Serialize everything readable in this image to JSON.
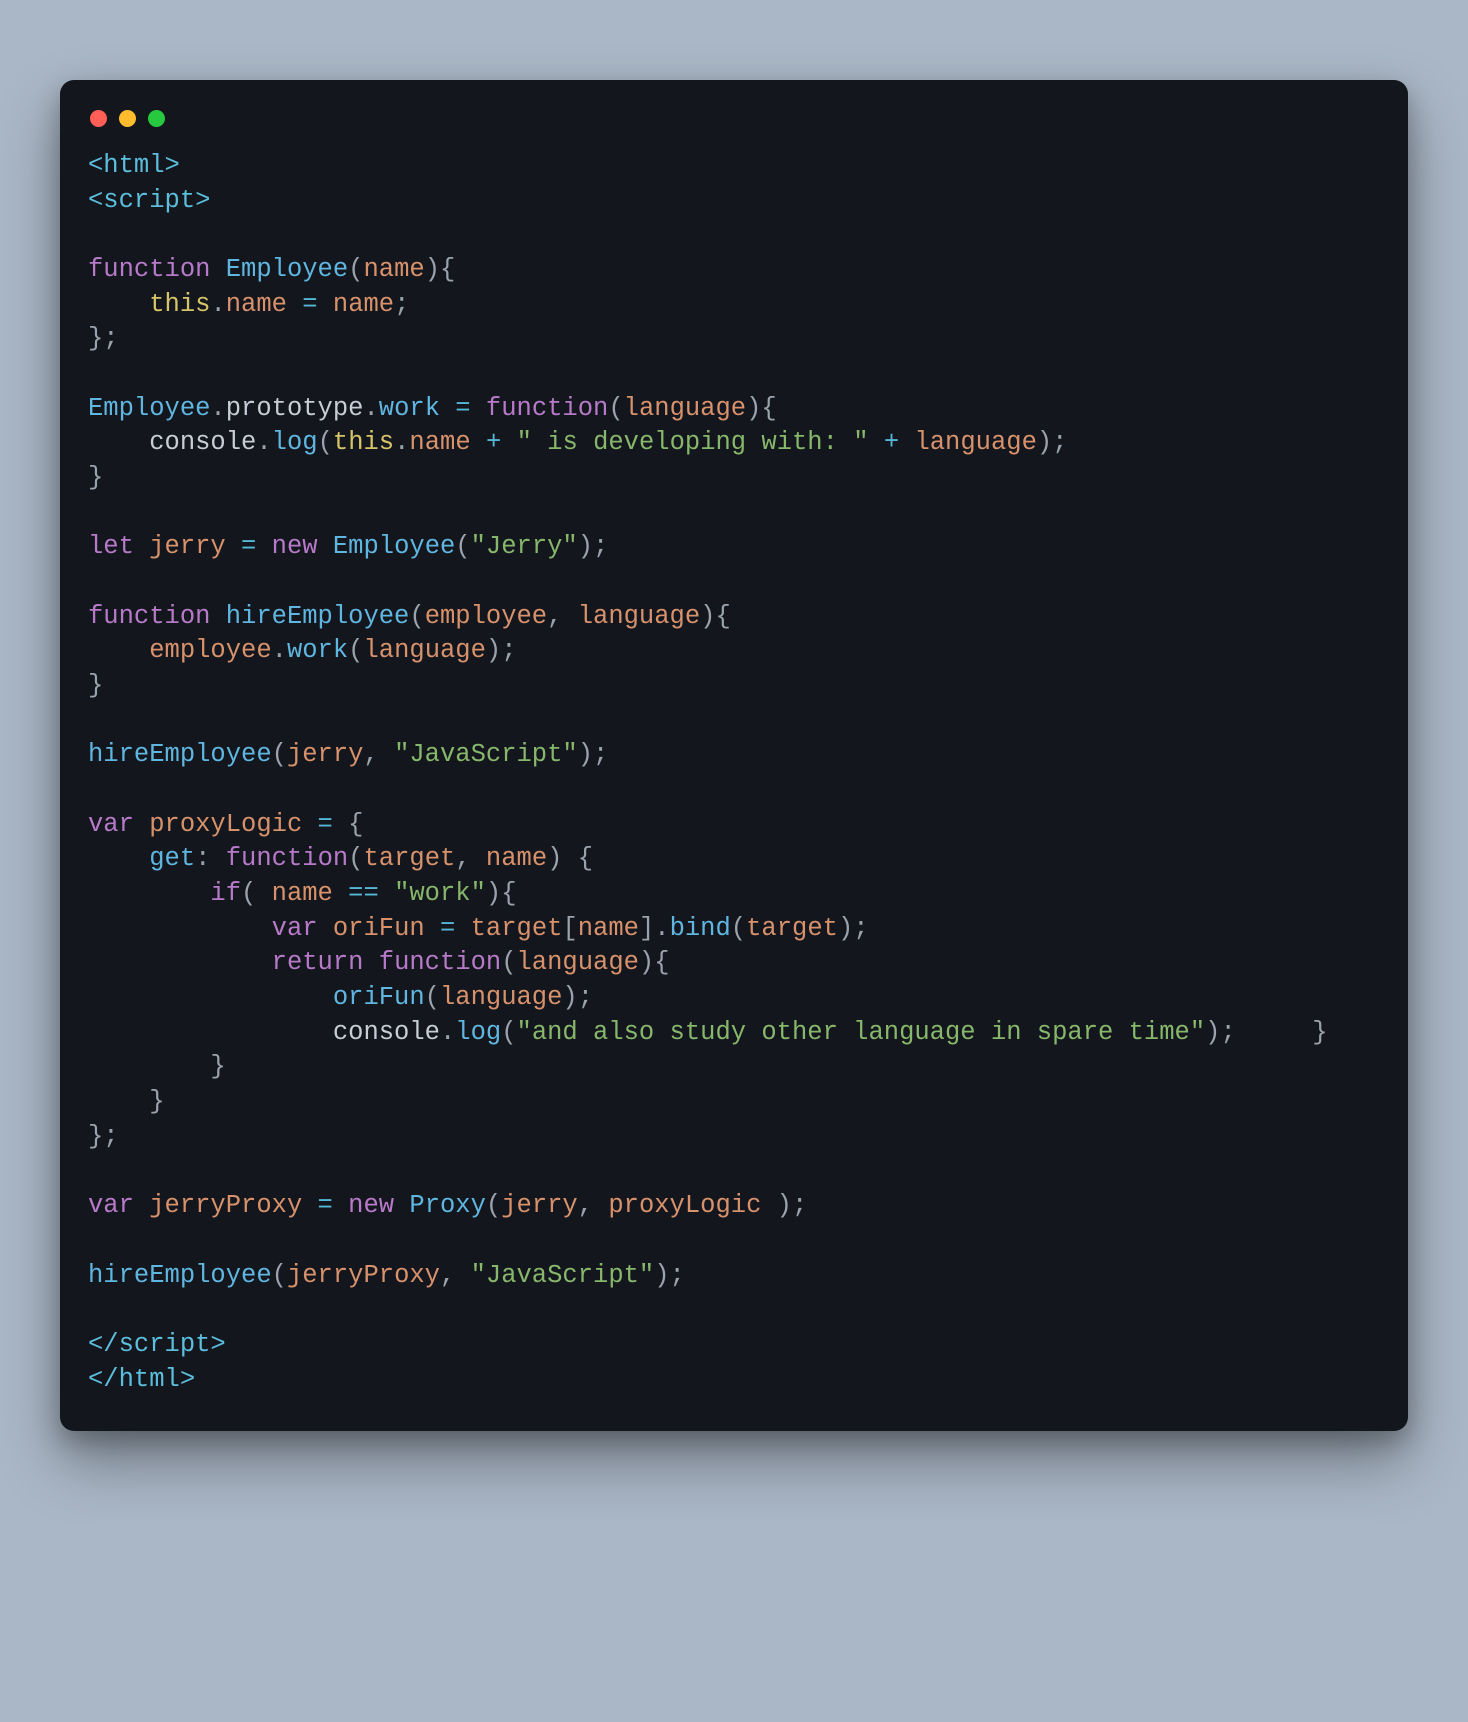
{
  "window": {
    "dots": [
      "red",
      "yellow",
      "green"
    ]
  },
  "code": {
    "tokens": [
      {
        "t": "<html>",
        "c": "tag"
      },
      {
        "t": "\n"
      },
      {
        "t": "<script>",
        "c": "tag"
      },
      {
        "t": "\n"
      },
      {
        "t": "\n"
      },
      {
        "t": "function ",
        "c": "kw"
      },
      {
        "t": "Employee",
        "c": "fn"
      },
      {
        "t": "(",
        "c": "punc"
      },
      {
        "t": "name",
        "c": "prop"
      },
      {
        "t": "){",
        "c": "punc"
      },
      {
        "t": "\n"
      },
      {
        "t": "    "
      },
      {
        "t": "this",
        "c": "this"
      },
      {
        "t": ".",
        "c": "punc"
      },
      {
        "t": "name",
        "c": "prop"
      },
      {
        "t": " = ",
        "c": "op"
      },
      {
        "t": "name",
        "c": "prop"
      },
      {
        "t": ";",
        "c": "punc"
      },
      {
        "t": "\n"
      },
      {
        "t": "};",
        "c": "punc"
      },
      {
        "t": "\n"
      },
      {
        "t": "\n"
      },
      {
        "t": "Employee",
        "c": "fn"
      },
      {
        "t": ".",
        "c": "punc"
      },
      {
        "t": "prototype",
        "c": "dotid"
      },
      {
        "t": ".",
        "c": "punc"
      },
      {
        "t": "work",
        "c": "fn"
      },
      {
        "t": " = ",
        "c": "op"
      },
      {
        "t": "function",
        "c": "kw"
      },
      {
        "t": "(",
        "c": "punc"
      },
      {
        "t": "language",
        "c": "prop"
      },
      {
        "t": "){",
        "c": "punc"
      },
      {
        "t": "\n"
      },
      {
        "t": "    "
      },
      {
        "t": "console",
        "c": "dotid"
      },
      {
        "t": ".",
        "c": "punc"
      },
      {
        "t": "log",
        "c": "fn"
      },
      {
        "t": "(",
        "c": "punc"
      },
      {
        "t": "this",
        "c": "this"
      },
      {
        "t": ".",
        "c": "punc"
      },
      {
        "t": "name",
        "c": "prop"
      },
      {
        "t": " + ",
        "c": "op"
      },
      {
        "t": "\" is developing with: \"",
        "c": "str"
      },
      {
        "t": " + ",
        "c": "op"
      },
      {
        "t": "language",
        "c": "prop"
      },
      {
        "t": ");",
        "c": "punc"
      },
      {
        "t": "\n"
      },
      {
        "t": "}",
        "c": "punc"
      },
      {
        "t": "\n"
      },
      {
        "t": "\n"
      },
      {
        "t": "let ",
        "c": "kw"
      },
      {
        "t": "jerry",
        "c": "prop"
      },
      {
        "t": " = ",
        "c": "op"
      },
      {
        "t": "new ",
        "c": "kw"
      },
      {
        "t": "Employee",
        "c": "fn"
      },
      {
        "t": "(",
        "c": "punc"
      },
      {
        "t": "\"Jerry\"",
        "c": "str"
      },
      {
        "t": ");",
        "c": "punc"
      },
      {
        "t": "\n"
      },
      {
        "t": "\n"
      },
      {
        "t": "function ",
        "c": "kw"
      },
      {
        "t": "hireEmployee",
        "c": "fn"
      },
      {
        "t": "(",
        "c": "punc"
      },
      {
        "t": "employee",
        "c": "prop"
      },
      {
        "t": ", ",
        "c": "punc"
      },
      {
        "t": "language",
        "c": "prop"
      },
      {
        "t": "){",
        "c": "punc"
      },
      {
        "t": "\n"
      },
      {
        "t": "    "
      },
      {
        "t": "employee",
        "c": "prop"
      },
      {
        "t": ".",
        "c": "punc"
      },
      {
        "t": "work",
        "c": "fn"
      },
      {
        "t": "(",
        "c": "punc"
      },
      {
        "t": "language",
        "c": "prop"
      },
      {
        "t": ");",
        "c": "punc"
      },
      {
        "t": "\n"
      },
      {
        "t": "}",
        "c": "punc"
      },
      {
        "t": "\n"
      },
      {
        "t": "\n"
      },
      {
        "t": "hireEmployee",
        "c": "fn"
      },
      {
        "t": "(",
        "c": "punc"
      },
      {
        "t": "jerry",
        "c": "prop"
      },
      {
        "t": ", ",
        "c": "punc"
      },
      {
        "t": "\"JavaScript\"",
        "c": "str"
      },
      {
        "t": ");",
        "c": "punc"
      },
      {
        "t": "\n"
      },
      {
        "t": "\n"
      },
      {
        "t": "var ",
        "c": "kw"
      },
      {
        "t": "proxyLogic",
        "c": "prop"
      },
      {
        "t": " = ",
        "c": "op"
      },
      {
        "t": "{",
        "c": "punc"
      },
      {
        "t": "\n"
      },
      {
        "t": "    "
      },
      {
        "t": "get",
        "c": "fn"
      },
      {
        "t": ": ",
        "c": "punc"
      },
      {
        "t": "function",
        "c": "kw"
      },
      {
        "t": "(",
        "c": "punc"
      },
      {
        "t": "target",
        "c": "prop"
      },
      {
        "t": ", ",
        "c": "punc"
      },
      {
        "t": "name",
        "c": "prop"
      },
      {
        "t": ") {",
        "c": "punc"
      },
      {
        "t": "\n"
      },
      {
        "t": "        "
      },
      {
        "t": "if",
        "c": "kw"
      },
      {
        "t": "( ",
        "c": "punc"
      },
      {
        "t": "name",
        "c": "prop"
      },
      {
        "t": " == ",
        "c": "op"
      },
      {
        "t": "\"work\"",
        "c": "str"
      },
      {
        "t": "){",
        "c": "punc"
      },
      {
        "t": "\n"
      },
      {
        "t": "            "
      },
      {
        "t": "var ",
        "c": "kw"
      },
      {
        "t": "oriFun",
        "c": "prop"
      },
      {
        "t": " = ",
        "c": "op"
      },
      {
        "t": "target",
        "c": "prop"
      },
      {
        "t": "[",
        "c": "punc"
      },
      {
        "t": "name",
        "c": "prop"
      },
      {
        "t": "].",
        "c": "punc"
      },
      {
        "t": "bind",
        "c": "fn"
      },
      {
        "t": "(",
        "c": "punc"
      },
      {
        "t": "target",
        "c": "prop"
      },
      {
        "t": ");",
        "c": "punc"
      },
      {
        "t": "\n"
      },
      {
        "t": "            "
      },
      {
        "t": "return ",
        "c": "kw"
      },
      {
        "t": "function",
        "c": "kw"
      },
      {
        "t": "(",
        "c": "punc"
      },
      {
        "t": "language",
        "c": "prop"
      },
      {
        "t": "){",
        "c": "punc"
      },
      {
        "t": "\n"
      },
      {
        "t": "                "
      },
      {
        "t": "oriFun",
        "c": "fn"
      },
      {
        "t": "(",
        "c": "punc"
      },
      {
        "t": "language",
        "c": "prop"
      },
      {
        "t": ");",
        "c": "punc"
      },
      {
        "t": "\n"
      },
      {
        "t": "                "
      },
      {
        "t": "console",
        "c": "dotid"
      },
      {
        "t": ".",
        "c": "punc"
      },
      {
        "t": "log",
        "c": "fn"
      },
      {
        "t": "(",
        "c": "punc"
      },
      {
        "t": "\"and also study other language in spare time\"",
        "c": "str"
      },
      {
        "t": ");",
        "c": "punc"
      },
      {
        "t": "     }",
        "c": "punc"
      },
      {
        "t": "\n"
      },
      {
        "t": "        }",
        "c": "punc"
      },
      {
        "t": "\n"
      },
      {
        "t": "    }",
        "c": "punc"
      },
      {
        "t": "\n"
      },
      {
        "t": "};",
        "c": "punc"
      },
      {
        "t": "\n"
      },
      {
        "t": "\n"
      },
      {
        "t": "var ",
        "c": "kw"
      },
      {
        "t": "jerryProxy",
        "c": "prop"
      },
      {
        "t": " = ",
        "c": "op"
      },
      {
        "t": "new ",
        "c": "kw"
      },
      {
        "t": "Proxy",
        "c": "fn"
      },
      {
        "t": "(",
        "c": "punc"
      },
      {
        "t": "jerry",
        "c": "prop"
      },
      {
        "t": ", ",
        "c": "punc"
      },
      {
        "t": "proxyLogic",
        "c": "prop"
      },
      {
        "t": " );",
        "c": "punc"
      },
      {
        "t": "\n"
      },
      {
        "t": "\n"
      },
      {
        "t": "hireEmployee",
        "c": "fn"
      },
      {
        "t": "(",
        "c": "punc"
      },
      {
        "t": "jerryProxy",
        "c": "prop"
      },
      {
        "t": ", ",
        "c": "punc"
      },
      {
        "t": "\"JavaScript\"",
        "c": "str"
      },
      {
        "t": ");",
        "c": "punc"
      },
      {
        "t": "\n"
      },
      {
        "t": "\n"
      },
      {
        "t": "</script>",
        "c": "tag"
      },
      {
        "t": "\n"
      },
      {
        "t": "</html>",
        "c": "tag"
      }
    ]
  }
}
